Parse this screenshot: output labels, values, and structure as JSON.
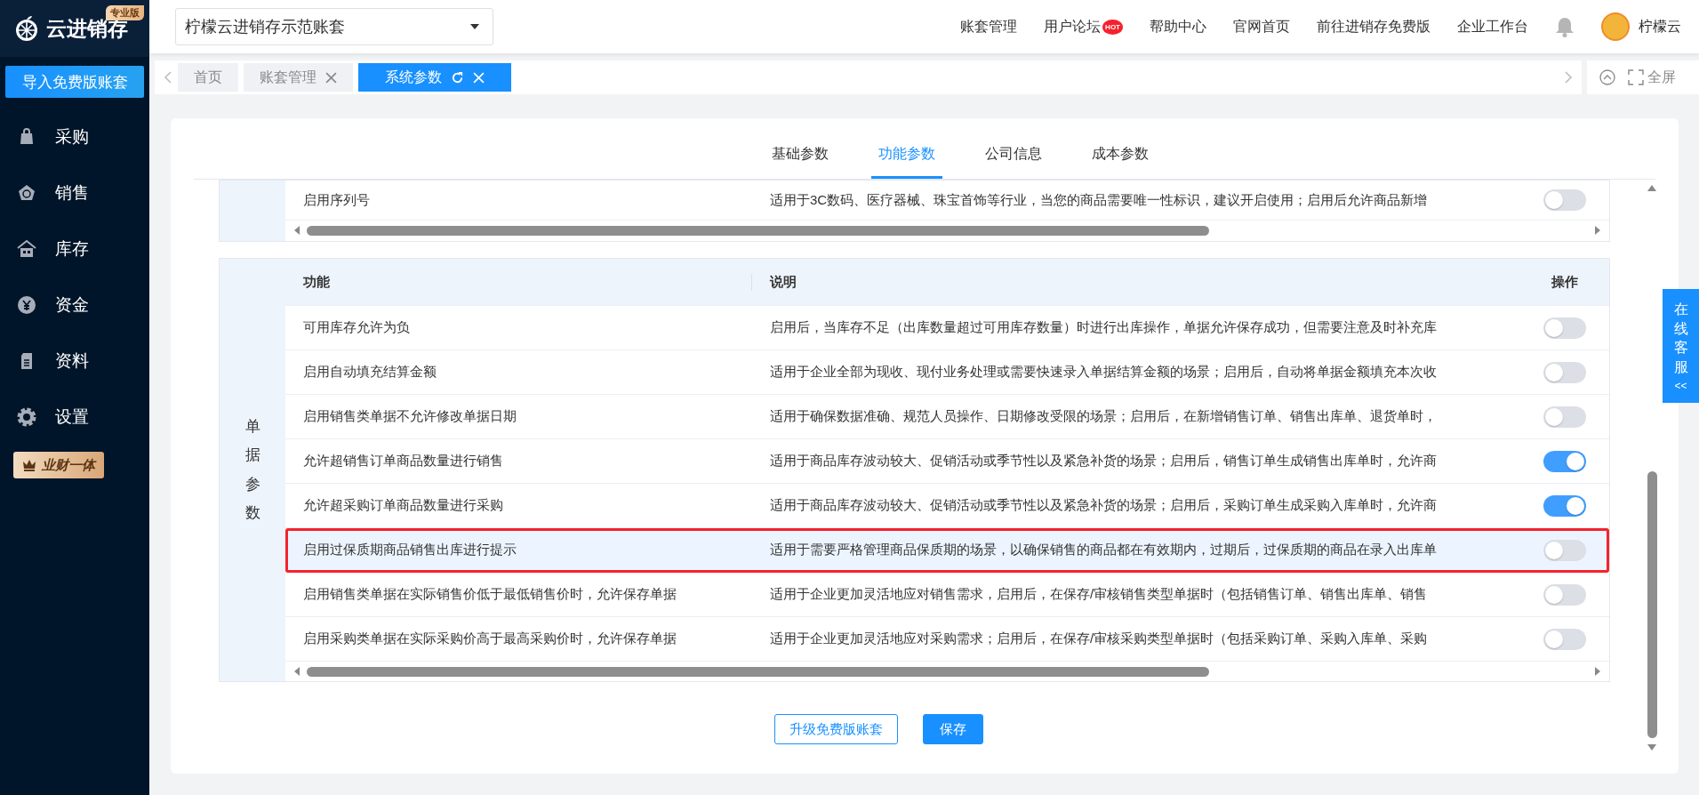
{
  "sidebar": {
    "logo": "云进销存",
    "edition_badge": "专业版",
    "import_button": "导入免费版账套",
    "items": [
      {
        "label": "采购"
      },
      {
        "label": "销售"
      },
      {
        "label": "库存"
      },
      {
        "label": "资金"
      },
      {
        "label": "资料"
      },
      {
        "label": "设置"
      }
    ],
    "promo_button": "业财一体"
  },
  "topbar": {
    "account_select": "柠檬云进销存示范账套",
    "links": [
      {
        "label": "账套管理"
      },
      {
        "label": "用户论坛",
        "badge": "HOT"
      },
      {
        "label": "帮助中心"
      },
      {
        "label": "官网首页"
      },
      {
        "label": "前往进销存免费版"
      },
      {
        "label": "企业工作台"
      }
    ],
    "user_name": "柠檬云"
  },
  "tabs": [
    {
      "label": "首页",
      "selected": false,
      "closable": false,
      "refreshable": false
    },
    {
      "label": "账套管理",
      "selected": false,
      "closable": true,
      "refreshable": false
    },
    {
      "label": "系统参数",
      "selected": true,
      "closable": true,
      "refreshable": true
    }
  ],
  "fullscreen": "全屏",
  "settings_tabs": [
    {
      "label": "基础参数",
      "selected": false
    },
    {
      "label": "功能参数",
      "selected": true
    },
    {
      "label": "公司信息",
      "selected": false
    },
    {
      "label": "成本参数",
      "selected": false
    }
  ],
  "partial_table": {
    "rows": [
      {
        "function": "启用序列号",
        "description": "适用于3C数码、医疗器械、珠宝首饰等行业，当您的商品需要唯一性标识，建议开启使用；启用后允许商品新增",
        "on": false
      }
    ]
  },
  "table": {
    "group": "单据参数",
    "columns": [
      "功能",
      "说明",
      "操作"
    ],
    "rows": [
      {
        "function": "可用库存允许为负",
        "description": "启用后，当库存不足（出库数量超过可用库存数量）时进行出库操作，单据允许保存成功，但需要注意及时补充库",
        "on": false,
        "selected": false
      },
      {
        "function": "启用自动填充结算金额",
        "description": "适用于企业全部为现收、现付业务处理或需要快速录入单据结算金额的场景；启用后，自动将单据金额填充本次收",
        "on": false,
        "selected": false
      },
      {
        "function": "启用销售类单据不允许修改单据日期",
        "description": "适用于确保数据准确、规范人员操作、日期修改受限的场景；启用后，在新增销售订单、销售出库单、退货单时，",
        "on": false,
        "selected": false
      },
      {
        "function": "允许超销售订单商品数量进行销售",
        "description": "适用于商品库存波动较大、促销活动或季节性以及紧急补货的场景；启用后，销售订单生成销售出库单时，允许商",
        "on": true,
        "selected": false
      },
      {
        "function": "允许超采购订单商品数量进行采购",
        "description": "适用于商品库存波动较大、促销活动或季节性以及紧急补货的场景；启用后，采购订单生成采购入库单时，允许商",
        "on": true,
        "selected": false
      },
      {
        "function": "启用过保质期商品销售出库进行提示",
        "description": "适用于需要严格管理商品保质期的场景，以确保销售的商品都在有效期内，过期后，过保质期的商品在录入出库单",
        "on": false,
        "selected": true
      },
      {
        "function": "启用销售类单据在实际销售价低于最低销售价时，允许保存单据",
        "description": "适用于企业更加灵活地应对销售需求，启用后，在保存/审核销售类型单据时（包括销售订单、销售出库单、销售",
        "on": false,
        "selected": false
      },
      {
        "function": "启用采购类单据在实际采购价高于最高采购价时，允许保存单据",
        "description": "适用于企业更加灵活地应对采购需求；启用后，在保存/审核采购类型单据时（包括采购订单、采购入库单、采购",
        "on": false,
        "selected": false
      }
    ]
  },
  "buttons": [
    {
      "label": "升级免费版账套",
      "kind": "secondary"
    },
    {
      "label": "保存",
      "kind": "primary"
    }
  ],
  "service_tab": {
    "label": "在线客服",
    "arrow": "<<"
  }
}
